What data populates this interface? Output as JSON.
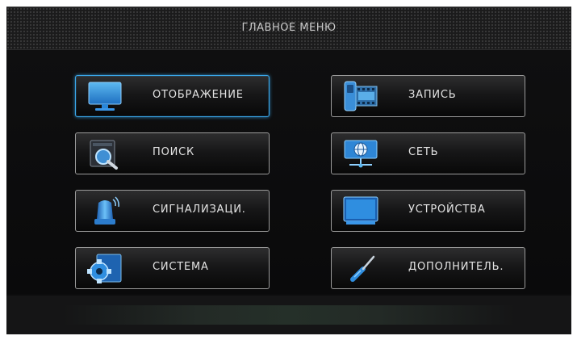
{
  "header": {
    "title": "ГЛАВНОЕ МЕНЮ"
  },
  "menu": {
    "items": [
      {
        "label": "ОТОБРАЖЕНИЕ",
        "icon": "monitor-icon",
        "selected": true
      },
      {
        "label": "ЗАПИСЬ",
        "icon": "film-record-icon",
        "selected": false
      },
      {
        "label": "ПОИСК",
        "icon": "search-icon",
        "selected": false
      },
      {
        "label": "СЕТЬ",
        "icon": "network-globe-icon",
        "selected": false
      },
      {
        "label": "СИГНАЛИЗАЦИ.",
        "icon": "alarm-beacon-icon",
        "selected": false
      },
      {
        "label": "УСТРОЙСТВА",
        "icon": "device-screen-icon",
        "selected": false
      },
      {
        "label": "СИСТЕМА",
        "icon": "gear-icon",
        "selected": false
      },
      {
        "label": "ДОПОЛНИТЕЛЬ.",
        "icon": "screwdriver-icon",
        "selected": false
      }
    ]
  },
  "colors": {
    "accent": "#3aa6e8",
    "icon_blue": "#2a86d8",
    "background": "#0c0c0d"
  }
}
